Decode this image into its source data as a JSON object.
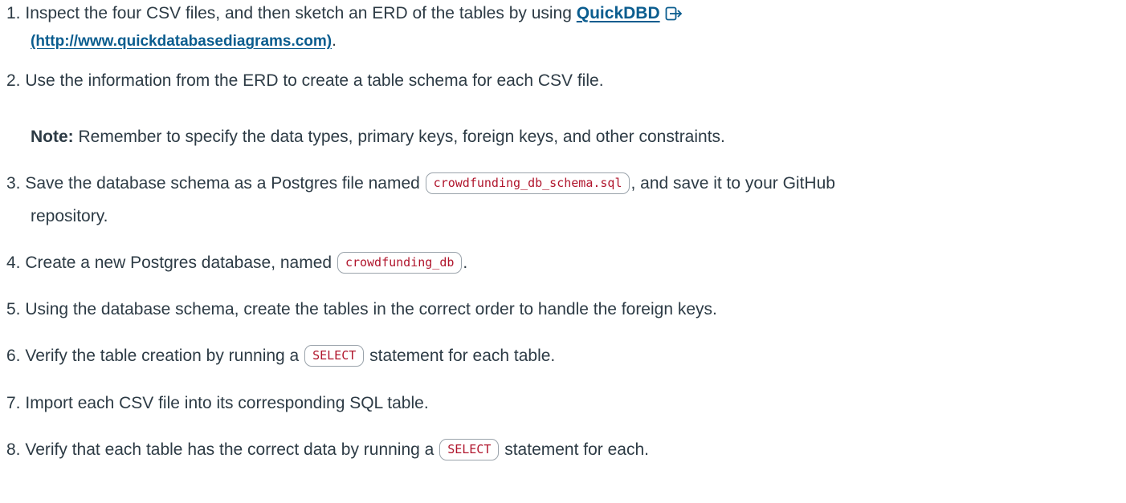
{
  "steps": [
    {
      "number": "1.",
      "text_before": "Inspect the four CSV files, and then sketch an ERD of the tables by using",
      "link_label": "QuickDBD",
      "link_url_text": "(http://www.quickdatabasediagrams.com)",
      "text_after": ".",
      "link_icon": "external-link-icon"
    },
    {
      "number": "2.",
      "text": "Use the information from the ERD to create a table schema for each CSV file."
    },
    {
      "note_label": "Note:",
      "note_text": "Remember to specify the data types, primary keys, foreign keys, and other constraints."
    },
    {
      "number": "3.",
      "text_before": "Save the database schema as a Postgres file named",
      "code": "crowdfunding_db_schema.sql",
      "text_after": ", and save it to your GitHub",
      "text_line2": "repository."
    },
    {
      "number": "4.",
      "text_before": "Create a new Postgres database, named",
      "code": "crowdfunding_db",
      "text_after": "."
    },
    {
      "number": "5.",
      "text": "Using the database schema, create the tables in the correct order to handle the foreign keys."
    },
    {
      "number": "6.",
      "text_before": "Verify the table creation by running a",
      "code": "SELECT",
      "text_after": "statement for each table."
    },
    {
      "number": "7.",
      "text": "Import each CSV file into its corresponding SQL table."
    },
    {
      "number": "8.",
      "text_before": "Verify that each table has the correct data by running a",
      "code": "SELECT",
      "text_after": "statement for each."
    }
  ]
}
